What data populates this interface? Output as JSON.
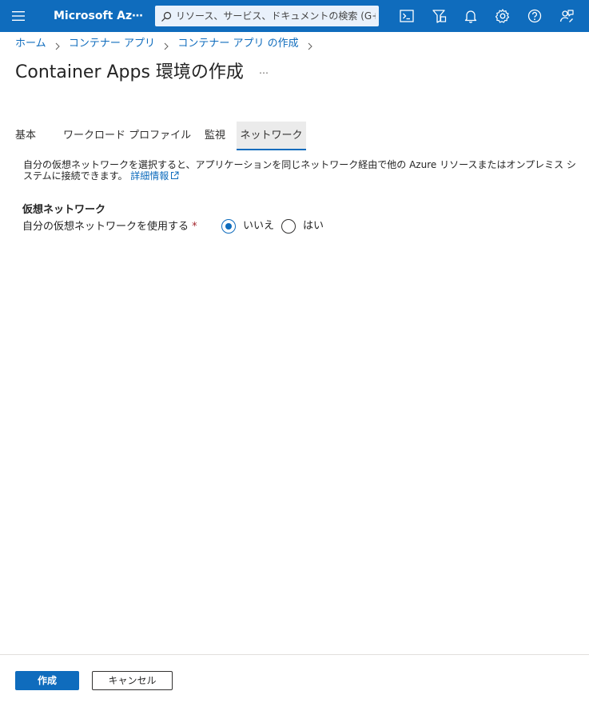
{
  "topbar": {
    "brand": "Microsoft Az⋯",
    "menu_icon": "hamburger-menu-icon",
    "search_placeholder": "リソース、サービス、ドキュメントの検索 (G+/)",
    "icons": [
      "cloud-shell-icon",
      "directory-filter-icon",
      "notifications-bell-icon",
      "settings-gear-icon",
      "help-question-icon",
      "feedback-icon"
    ],
    "bg_color": "#0f6cbd"
  },
  "breadcrumb": {
    "items": [
      "ホーム",
      "コンテナー アプリ",
      "コンテナー アプリ の作成"
    ]
  },
  "page": {
    "title": "Container Apps 環境の作成",
    "more_label": "⋯"
  },
  "tabs": [
    {
      "label": "基本",
      "selected": false
    },
    {
      "label": "ワークロード プロファイル",
      "selected": false
    },
    {
      "label": "監視",
      "selected": false
    },
    {
      "label": "ネットワーク",
      "selected": true
    }
  ],
  "description": {
    "text": "自分の仮想ネットワークを選択すると、アプリケーションを同じネットワーク経由で他の Azure リソースまたはオンプレミス システムに接続できます。",
    "link_label": "詳細情報"
  },
  "network": {
    "section_title": "仮想ネットワーク",
    "field_label": "自分の仮想ネットワークを使用する",
    "required_mark": "*",
    "options": [
      {
        "label": "いいえ",
        "selected": true
      },
      {
        "label": "はい",
        "selected": false
      }
    ]
  },
  "footer": {
    "create_label": "作成",
    "cancel_label": "キャンセル"
  }
}
